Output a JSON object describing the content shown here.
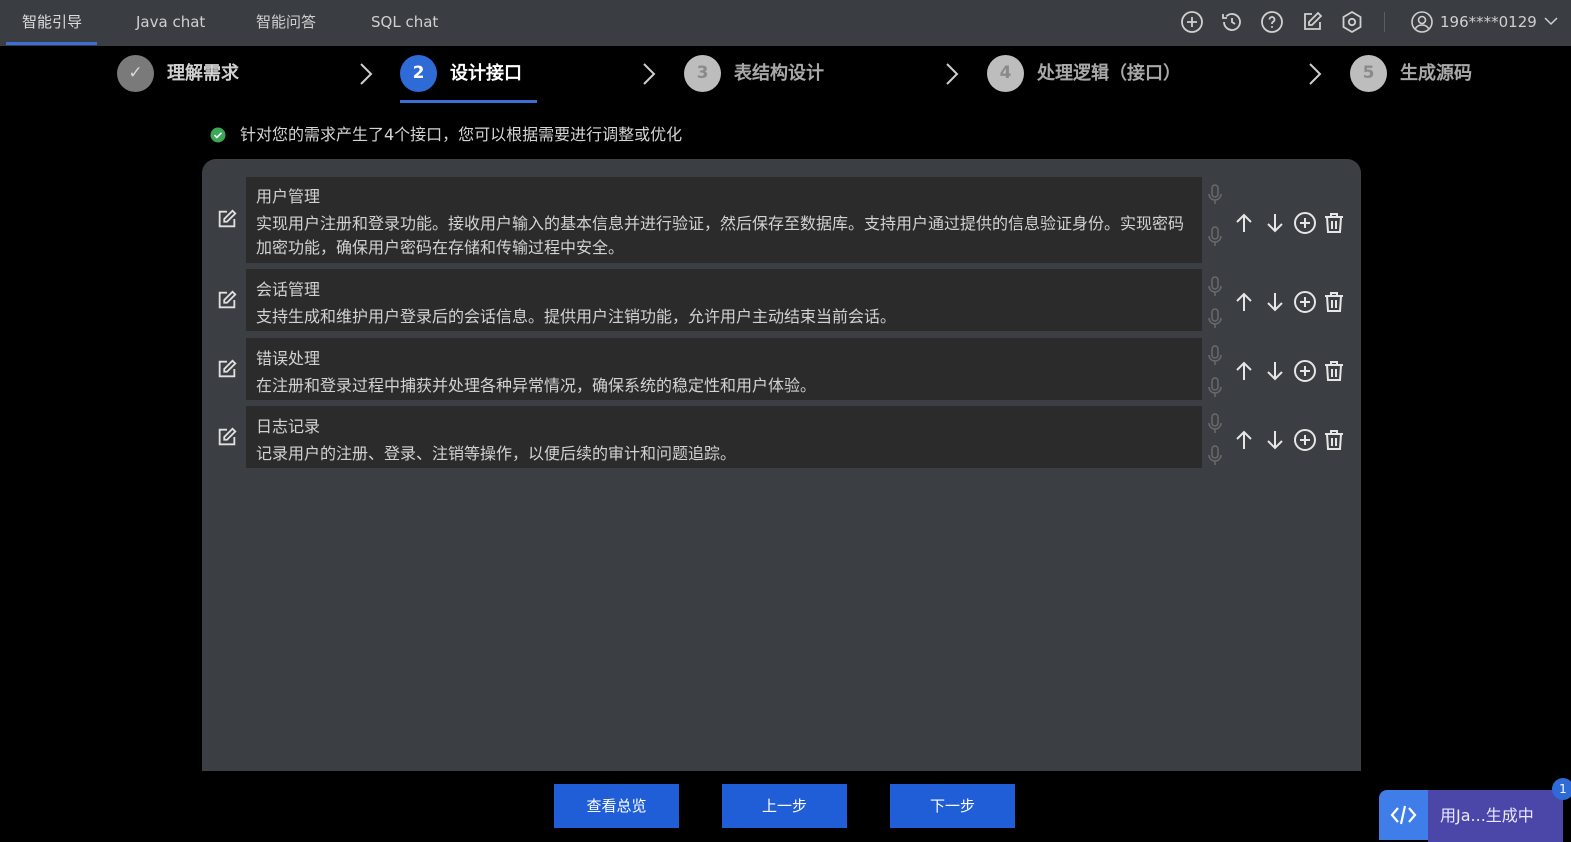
{
  "tabs": [
    {
      "label": "智能引导",
      "active": true
    },
    {
      "label": "Java chat",
      "active": false
    },
    {
      "label": "智能问答",
      "active": false
    },
    {
      "label": "SQL chat",
      "active": false
    }
  ],
  "toolbar_icons": [
    "add-circle-icon",
    "history-icon",
    "help-icon",
    "edit-icon",
    "settings-icon"
  ],
  "user": {
    "name": "196****0129",
    "icon": "user-circle-icon"
  },
  "steps": [
    {
      "number": "",
      "label": "理解需求",
      "state": "done"
    },
    {
      "number": "2",
      "label": "设计接口",
      "state": "current"
    },
    {
      "number": "3",
      "label": "表结构设计",
      "state": "pending"
    },
    {
      "number": "4",
      "label": "处理逻辑（接口）",
      "state": "pending"
    },
    {
      "number": "5",
      "label": "生成源码",
      "state": "pending"
    }
  ],
  "message": "针对您的需求产生了4个接口，您可以根据需要进行调整或优化",
  "interfaces": [
    {
      "title": "用户管理",
      "desc": "实现用户注册和登录功能。接收用户输入的基本信息并进行验证，然后保存至数据库。支持用户通过提供的信息验证身份。实现密码加密功能，确保用户密码在存储和传输过程中安全。"
    },
    {
      "title": "会话管理",
      "desc": "支持生成和维护用户登录后的会话信息。提供用户注销功能，允许用户主动结束当前会话。"
    },
    {
      "title": "错误处理",
      "desc": "在注册和登录过程中捕获并处理各种异常情况，确保系统的稳定性和用户体验。"
    },
    {
      "title": "日志记录",
      "desc": "记录用户的注册、登录、注销等操作，以便后续的审计和问题追踪。"
    }
  ],
  "buttons": {
    "overview": "查看总览",
    "prev": "上一步",
    "next": "下一步"
  },
  "floating": {
    "label": "用Ja...生成中",
    "badge": "1"
  },
  "colors": {
    "accent": "#1f5ed6",
    "topbar": "#3a3d41",
    "panel": "#3b3e42",
    "success": "#3aa857"
  }
}
